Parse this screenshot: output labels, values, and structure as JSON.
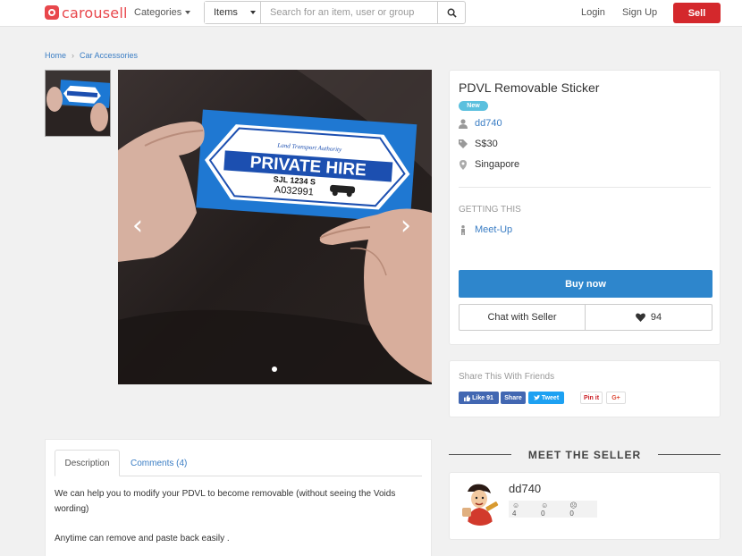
{
  "header": {
    "logo_text": "carousell",
    "categories_label": "Categories",
    "search": {
      "scope": "Items",
      "placeholder": "Search for an item, user or group"
    },
    "login": "Login",
    "signup": "Sign Up",
    "sell": "Sell"
  },
  "breadcrumb": [
    "Home",
    "Car Accessories"
  ],
  "gallery": {
    "photo_sign": {
      "authority": "Land Transport Authority",
      "headline": "PRIVATE HIRE",
      "plate": "SJL 1234 S",
      "number": "A032991"
    }
  },
  "product": {
    "title": "PDVL Removable Sticker",
    "badge": "New",
    "seller": "dd740",
    "price": "S$30",
    "location": "Singapore",
    "getting_label": "GETTING THIS",
    "meetup": "Meet-Up",
    "buy_label": "Buy now",
    "chat_label": "Chat with Seller",
    "likes": "94"
  },
  "share": {
    "title": "Share This With Friends",
    "fb_like": "Like 91",
    "fb_share": "Share",
    "tweet": "Tweet",
    "pin": "Pin it",
    "gplus": "G+"
  },
  "description": {
    "tab_description": "Description",
    "tab_comments": "Comments (4)",
    "line1": "We can help you to modify your PDVL to become removable (without seeing the Voids wording)",
    "line2": "Anytime can remove and paste back easily ."
  },
  "seller_card": {
    "heading": "MEET THE SELLER",
    "name": "dd740",
    "positive": "4",
    "neutral": "0",
    "negative": "0"
  },
  "colors": {
    "brand_red": "#e8474c",
    "sell_red": "#d4282c",
    "buy_blue": "#2e86cc",
    "link_blue": "#3a7dc4",
    "badge_cyan": "#5bc0de"
  }
}
